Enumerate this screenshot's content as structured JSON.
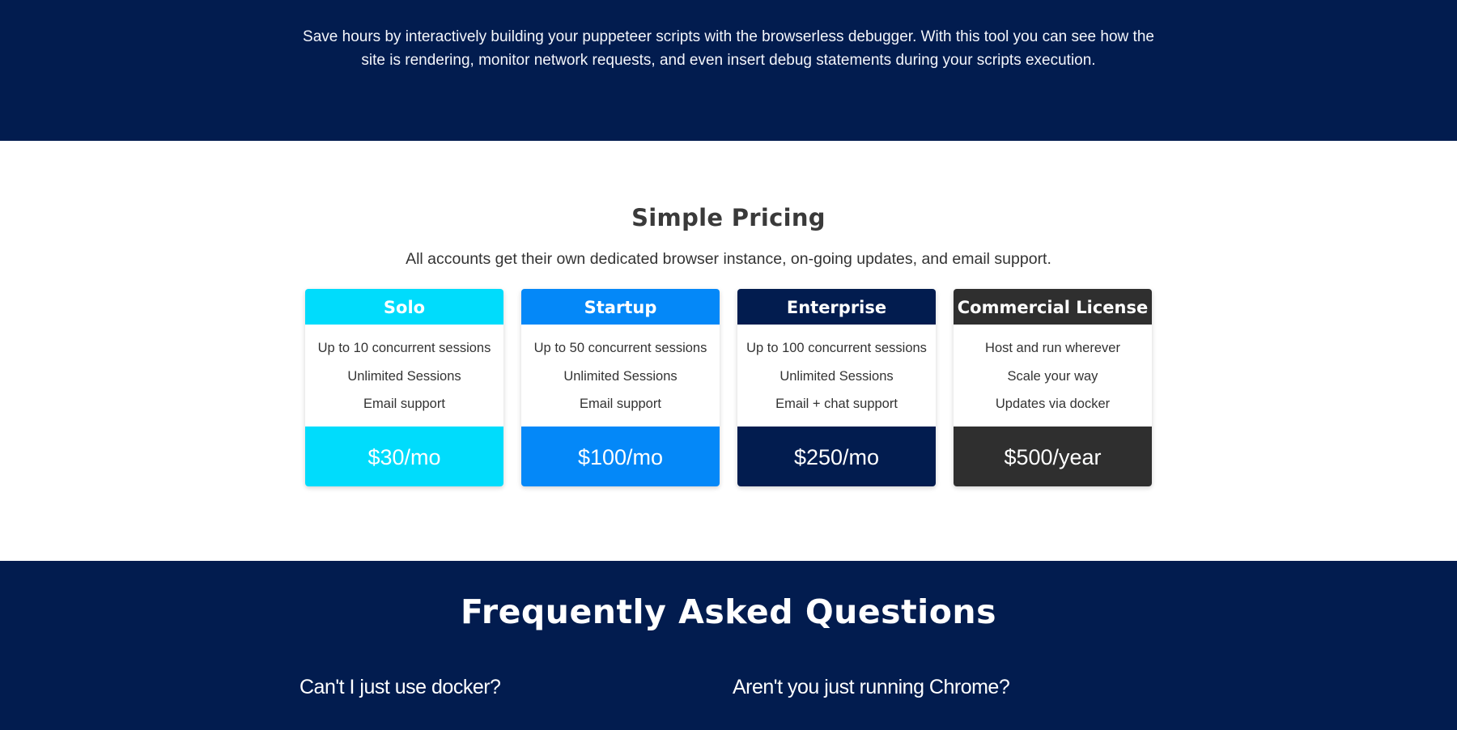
{
  "hero": {
    "description": "Save hours by interactively building your puppeteer scripts with the browserless debugger. With this tool you can see how the site is rendering, monitor network requests, and even insert debug statements during your scripts execution."
  },
  "pricing": {
    "title": "Simple Pricing",
    "subtitle": "All accounts get their own dedicated browser instance, on-going updates, and email support.",
    "plans": [
      {
        "name": "Solo",
        "color": "#00dcfc",
        "features": [
          "Up to 10 concurrent sessions",
          "Unlimited Sessions",
          "Email support"
        ],
        "price": "$30/mo"
      },
      {
        "name": "Startup",
        "color": "#0488f8",
        "features": [
          "Up to 50 concurrent sessions",
          "Unlimited Sessions",
          "Email support"
        ],
        "price": "$100/mo"
      },
      {
        "name": "Enterprise",
        "color": "#021c4f",
        "features": [
          "Up to 100 concurrent sessions",
          "Unlimited Sessions",
          "Email + chat support"
        ],
        "price": "$250/mo"
      },
      {
        "name": "Commercial License",
        "color": "#2f2f2f",
        "features": [
          "Host and run wherever",
          "Scale your way",
          "Updates via docker"
        ],
        "price": "$500/year"
      }
    ]
  },
  "faq": {
    "title": "Frequently Asked Questions",
    "questions": [
      "Can't I just use docker?",
      "Aren't you just running Chrome?"
    ]
  },
  "colors": {
    "navy": "#021c4f",
    "solo": "#00dcfc",
    "startup": "#0488f8",
    "enterprise": "#021c4f",
    "commercial": "#2f2f2f"
  }
}
